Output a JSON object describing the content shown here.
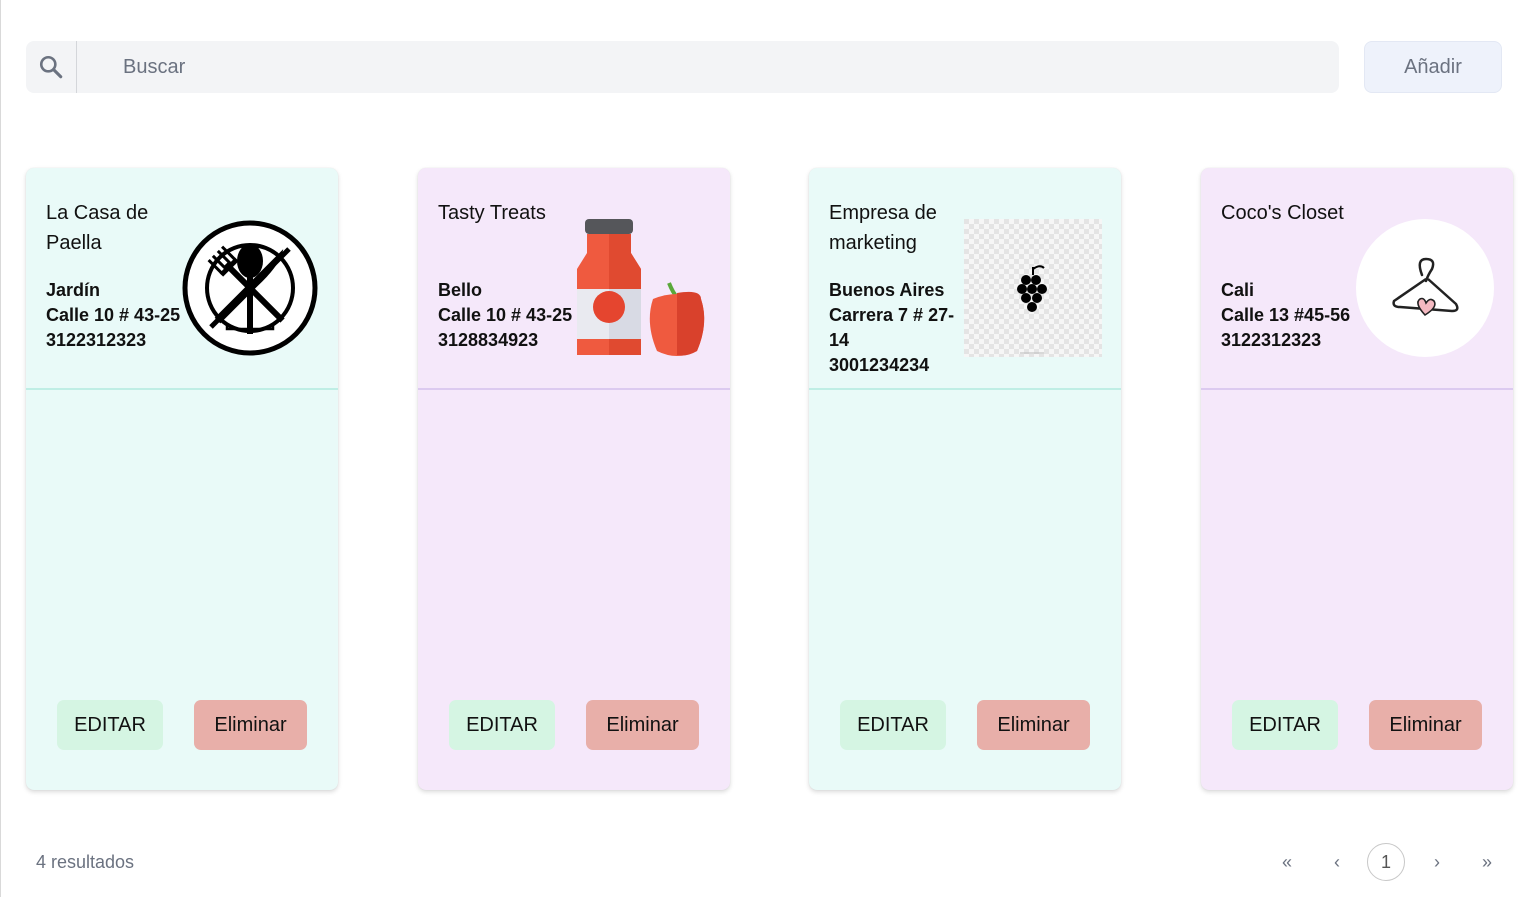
{
  "search": {
    "placeholder": "Buscar",
    "value": ""
  },
  "toolbar": {
    "add_label": "Añadir"
  },
  "cards": [
    {
      "name": "La Casa de Paella",
      "city": "Jardín",
      "address": "Calle 10 # 43-25",
      "phone": "3122312323",
      "edit_label": "EDITAR",
      "delete_label": "Eliminar",
      "logo": "restaurant-utensils-icon"
    },
    {
      "name": "Tasty Treats",
      "city": "Bello",
      "address": "Calle 10 # 43-25",
      "phone": "3128834923",
      "edit_label": "EDITAR",
      "delete_label": "Eliminar",
      "logo": "sauce-bottle-pepper-icon"
    },
    {
      "name": "Empresa de marketing",
      "city": "Buenos Aires",
      "address": "Carrera 7 # 27-14",
      "phone": "3001234234",
      "edit_label": "EDITAR",
      "delete_label": "Eliminar",
      "logo": "grapes-icon"
    },
    {
      "name": "Coco's Closet",
      "city": "Cali",
      "address": "Calle 13 #45-56",
      "phone": "3122312323",
      "edit_label": "EDITAR",
      "delete_label": "Eliminar",
      "logo": "hanger-heart-icon"
    }
  ],
  "footer": {
    "results_text": "4 resultados",
    "pagination": {
      "first": "«",
      "prev": "‹",
      "current": "1",
      "next": "›",
      "last": "»"
    }
  },
  "colors": {
    "teal_card": "#e9faf8",
    "purple_card": "#f5e8fa",
    "edit_button": "#d5f5e3",
    "delete_button": "#e8afa9"
  }
}
